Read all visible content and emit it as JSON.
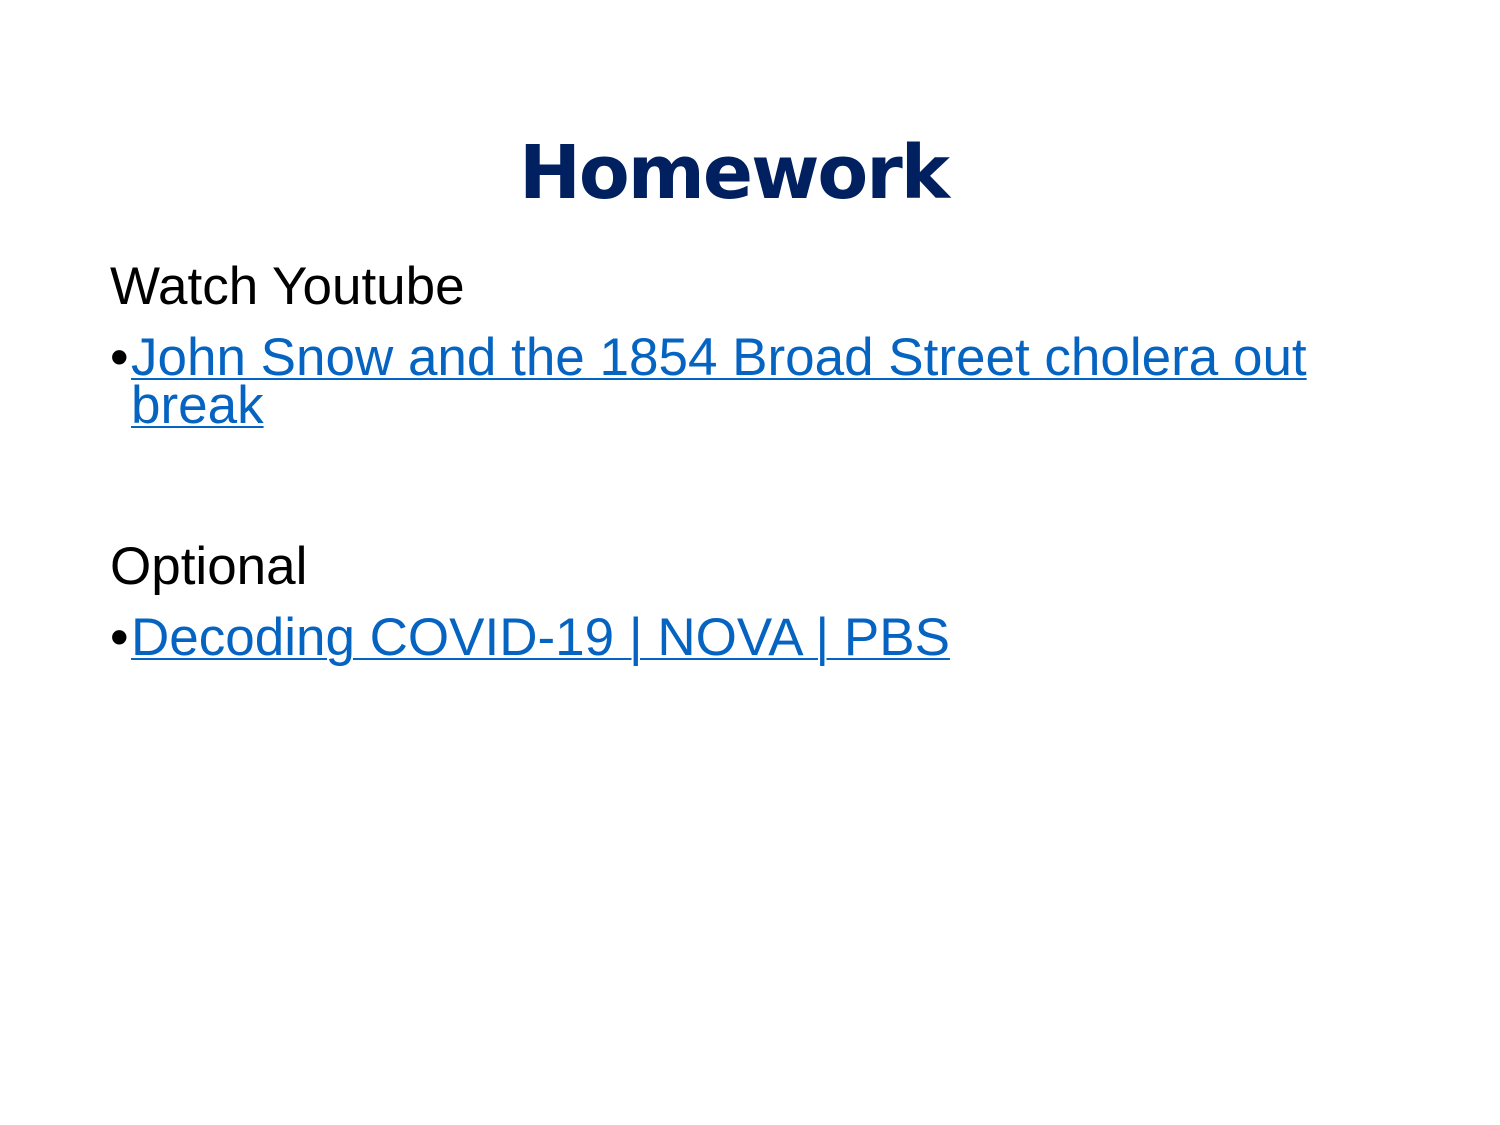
{
  "slide": {
    "title": "Homework",
    "colors": {
      "title": "#002060",
      "link": "#0563c1",
      "text": "#000000",
      "background": "#ffffff"
    },
    "sections": [
      {
        "label": "Watch Youtube",
        "bullet": "•",
        "link_text": "John Snow and the 1854 Broad Street cholera out break"
      },
      {
        "label": "Optional",
        "bullet": "•",
        "link_text": "Decoding COVID-19 | NOVA | PBS"
      }
    ]
  }
}
